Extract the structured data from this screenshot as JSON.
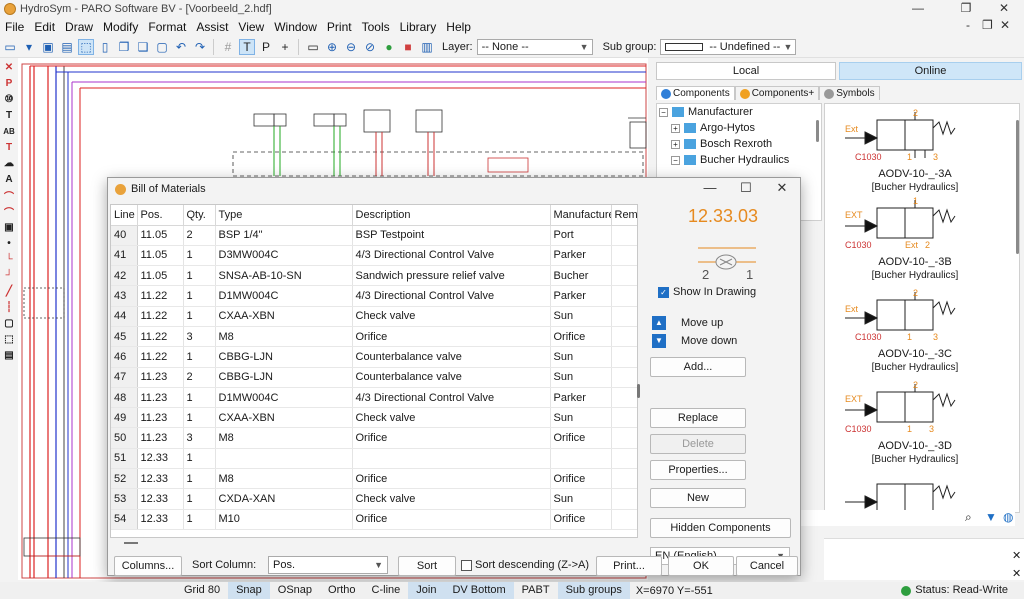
{
  "window": {
    "title": "HydroSym - PARO Software BV - [Voorbeeld_2.hdf]",
    "minimize": "—",
    "restore": "❐",
    "close": "✕"
  },
  "menu": [
    "File",
    "Edit",
    "Draw",
    "Modify",
    "Format",
    "Assist",
    "View",
    "Window",
    "Print",
    "Tools",
    "Library",
    "Help"
  ],
  "menu_right": {
    "min": "-",
    "restore": "❐",
    "close": "✕"
  },
  "toolbar": {
    "layer_label": "Layer:",
    "layer_value": "-- None --",
    "subgroup_label": "Sub group:",
    "subgroup_value": "-- Undefined --"
  },
  "library": {
    "local": "Local",
    "online": "Online",
    "tabs": [
      "Components",
      "Components+",
      "Symbols"
    ],
    "tree": [
      {
        "label": "Manufacturer",
        "indent": 0,
        "exp": "−"
      },
      {
        "label": "Argo-Hytos",
        "indent": 1,
        "exp": "+"
      },
      {
        "label": "Bosch Rexroth",
        "indent": 1,
        "exp": "+"
      },
      {
        "label": "Bucher Hydraulics",
        "indent": 1,
        "exp": "−"
      }
    ],
    "symbols": [
      {
        "name": "AODV-10-_-3A",
        "manufacturer": "[Bucher Hydraulics]",
        "ext": "Ext",
        "code": "C1030",
        "p1": "1",
        "p2": "2",
        "p3": "3"
      },
      {
        "name": "AODV-10-_-3B",
        "manufacturer": "[Bucher Hydraulics]",
        "ext": "EXT",
        "code": "C1030",
        "p1": "1",
        "p2": "2",
        "p3": "Ext"
      },
      {
        "name": "AODV-10-_-3C",
        "manufacturer": "[Bucher Hydraulics]",
        "ext": "Ext",
        "code": "C1030",
        "p1": "1",
        "p2": "2",
        "p3": "3"
      },
      {
        "name": "AODV-10-_-3D",
        "manufacturer": "[Bucher Hydraulics]",
        "ext": "EXT",
        "code": "C1030",
        "p1": "1",
        "p2": "2",
        "p3": "3"
      }
    ]
  },
  "dialog": {
    "title": "Bill of Materials",
    "columns": [
      "Line",
      "Pos.",
      "Qty.",
      "Type",
      "Description",
      "Manufacturer",
      "Rem"
    ],
    "rows": [
      [
        "40",
        "11.05",
        "2",
        "BSP 1/4\"",
        "BSP Testpoint",
        "Port"
      ],
      [
        "41",
        "11.05",
        "1",
        "D3MW004C",
        "4/3 Directional Control Valve",
        "Parker"
      ],
      [
        "42",
        "11.05",
        "1",
        "SNSA-AB-10-SN",
        "Sandwich pressure relief valve",
        "Bucher"
      ],
      [
        "43",
        "11.22",
        "1",
        "D1MW004C",
        "4/3 Directional Control Valve",
        "Parker"
      ],
      [
        "44",
        "11.22",
        "1",
        "CXAA-XBN",
        "Check valve",
        "Sun"
      ],
      [
        "45",
        "11.22",
        "3",
        "M8",
        "Orifice",
        "Orifice"
      ],
      [
        "46",
        "11.22",
        "1",
        "CBBG-LJN",
        "Counterbalance valve",
        "Sun"
      ],
      [
        "47",
        "11.23",
        "2",
        "CBBG-LJN",
        "Counterbalance valve",
        "Sun"
      ],
      [
        "48",
        "11.23",
        "1",
        "D1MW004C",
        "4/3 Directional Control Valve",
        "Parker"
      ],
      [
        "49",
        "11.23",
        "1",
        "CXAA-XBN",
        "Check valve",
        "Sun"
      ],
      [
        "50",
        "11.23",
        "3",
        "M8",
        "Orifice",
        "Orifice"
      ],
      [
        "51",
        "12.33",
        "1",
        "",
        "",
        ""
      ],
      [
        "52",
        "12.33",
        "1",
        "M8",
        "Orifice",
        "Orifice"
      ],
      [
        "53",
        "12.33",
        "1",
        "CXDA-XAN",
        "Check valve",
        "Sun"
      ],
      [
        "54",
        "12.33",
        "1",
        "M10",
        "Orifice",
        "Orifice"
      ]
    ],
    "position_value": "12.33.03",
    "indicator_left": "2",
    "indicator_right": "1",
    "show_in_drawing": "Show In Drawing",
    "move_up": "Move up",
    "move_down": "Move down",
    "add": "Add...",
    "replace": "Replace",
    "delete": "Delete",
    "properties": "Properties...",
    "new": "New",
    "hidden_components": "Hidden Components",
    "language": "EN (English)",
    "columns_btn": "Columns...",
    "sort_column_label": "Sort Column:",
    "sort_column_value": "Pos.",
    "sort_btn": "Sort",
    "sort_desc": "Sort descending (Z->A)",
    "print": "Print...",
    "ok": "OK",
    "cancel": "Cancel",
    "minimize": "—",
    "maximize": "☐",
    "close": "✕"
  },
  "statusbar": {
    "items": [
      {
        "label": "Grid 80",
        "on": false
      },
      {
        "label": "Snap",
        "on": true
      },
      {
        "label": "OSnap",
        "on": false
      },
      {
        "label": "Ortho",
        "on": false
      },
      {
        "label": "C-line",
        "on": false
      },
      {
        "label": "Join",
        "on": true
      },
      {
        "label": "DV Bottom",
        "on": true
      },
      {
        "label": "PABT",
        "on": false
      },
      {
        "label": "Sub groups",
        "on": true
      }
    ],
    "coords": "X=6970 Y=-551",
    "status": "Status: Read-Write"
  },
  "colors": {
    "accent": "#1f6fc5",
    "coord": "#e68a1f",
    "online": "#cfe6f8"
  }
}
